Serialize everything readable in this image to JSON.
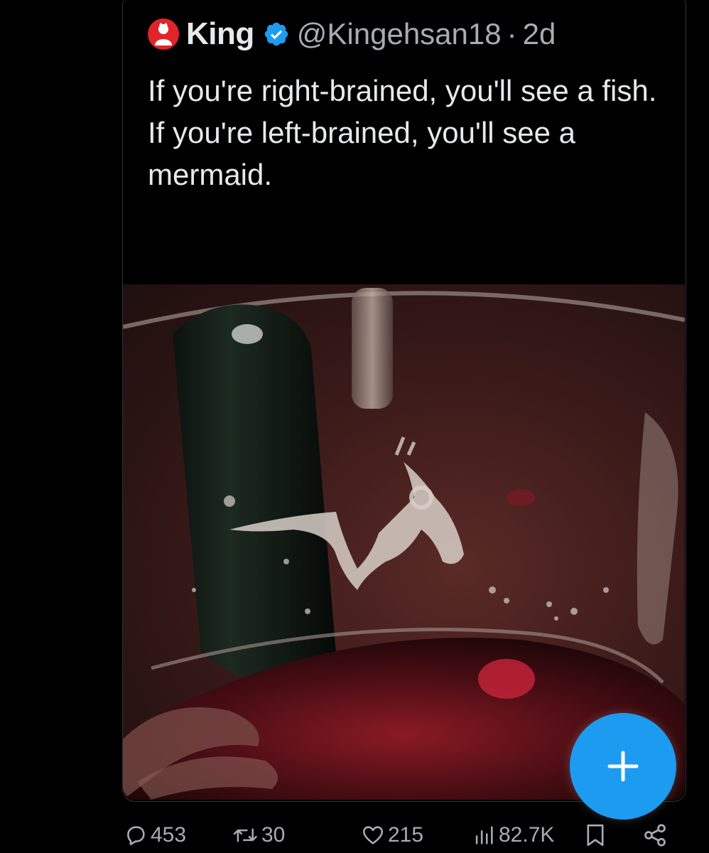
{
  "tweet": {
    "display_name": "King",
    "handle": "@Kingehsan18",
    "separator": "·",
    "timestamp": "2d",
    "text": "If you're right-brained, you'll see a fish. If you're left-brained, you'll see a mermaid."
  },
  "actions": {
    "replies": "453",
    "reposts": "30",
    "likes": "215",
    "views": "82.7K"
  },
  "colors": {
    "accent": "#1d9bf0",
    "background": "#000000",
    "text": "#e7e9ea",
    "secondary_text": "#a6adb4",
    "avatar": "#e0242a"
  },
  "icons": {
    "verified": "verified-badge-icon",
    "reply": "reply-icon",
    "repost": "repost-icon",
    "like": "heart-icon",
    "views": "views-chart-icon",
    "bookmark": "bookmark-icon",
    "share": "share-icon",
    "compose": "plus-icon"
  }
}
